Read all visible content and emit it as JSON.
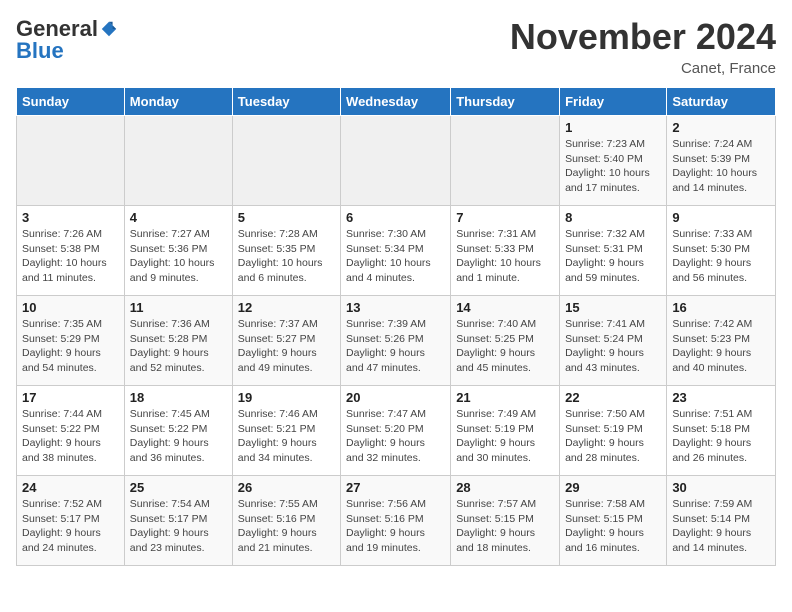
{
  "logo": {
    "general": "General",
    "blue": "Blue"
  },
  "title": "November 2024",
  "location": "Canet, France",
  "days_of_week": [
    "Sunday",
    "Monday",
    "Tuesday",
    "Wednesday",
    "Thursday",
    "Friday",
    "Saturday"
  ],
  "weeks": [
    [
      {
        "day": "",
        "info": ""
      },
      {
        "day": "",
        "info": ""
      },
      {
        "day": "",
        "info": ""
      },
      {
        "day": "",
        "info": ""
      },
      {
        "day": "",
        "info": ""
      },
      {
        "day": "1",
        "info": "Sunrise: 7:23 AM\nSunset: 5:40 PM\nDaylight: 10 hours and 17 minutes."
      },
      {
        "day": "2",
        "info": "Sunrise: 7:24 AM\nSunset: 5:39 PM\nDaylight: 10 hours and 14 minutes."
      }
    ],
    [
      {
        "day": "3",
        "info": "Sunrise: 7:26 AM\nSunset: 5:38 PM\nDaylight: 10 hours and 11 minutes."
      },
      {
        "day": "4",
        "info": "Sunrise: 7:27 AM\nSunset: 5:36 PM\nDaylight: 10 hours and 9 minutes."
      },
      {
        "day": "5",
        "info": "Sunrise: 7:28 AM\nSunset: 5:35 PM\nDaylight: 10 hours and 6 minutes."
      },
      {
        "day": "6",
        "info": "Sunrise: 7:30 AM\nSunset: 5:34 PM\nDaylight: 10 hours and 4 minutes."
      },
      {
        "day": "7",
        "info": "Sunrise: 7:31 AM\nSunset: 5:33 PM\nDaylight: 10 hours and 1 minute."
      },
      {
        "day": "8",
        "info": "Sunrise: 7:32 AM\nSunset: 5:31 PM\nDaylight: 9 hours and 59 minutes."
      },
      {
        "day": "9",
        "info": "Sunrise: 7:33 AM\nSunset: 5:30 PM\nDaylight: 9 hours and 56 minutes."
      }
    ],
    [
      {
        "day": "10",
        "info": "Sunrise: 7:35 AM\nSunset: 5:29 PM\nDaylight: 9 hours and 54 minutes."
      },
      {
        "day": "11",
        "info": "Sunrise: 7:36 AM\nSunset: 5:28 PM\nDaylight: 9 hours and 52 minutes."
      },
      {
        "day": "12",
        "info": "Sunrise: 7:37 AM\nSunset: 5:27 PM\nDaylight: 9 hours and 49 minutes."
      },
      {
        "day": "13",
        "info": "Sunrise: 7:39 AM\nSunset: 5:26 PM\nDaylight: 9 hours and 47 minutes."
      },
      {
        "day": "14",
        "info": "Sunrise: 7:40 AM\nSunset: 5:25 PM\nDaylight: 9 hours and 45 minutes."
      },
      {
        "day": "15",
        "info": "Sunrise: 7:41 AM\nSunset: 5:24 PM\nDaylight: 9 hours and 43 minutes."
      },
      {
        "day": "16",
        "info": "Sunrise: 7:42 AM\nSunset: 5:23 PM\nDaylight: 9 hours and 40 minutes."
      }
    ],
    [
      {
        "day": "17",
        "info": "Sunrise: 7:44 AM\nSunset: 5:22 PM\nDaylight: 9 hours and 38 minutes."
      },
      {
        "day": "18",
        "info": "Sunrise: 7:45 AM\nSunset: 5:22 PM\nDaylight: 9 hours and 36 minutes."
      },
      {
        "day": "19",
        "info": "Sunrise: 7:46 AM\nSunset: 5:21 PM\nDaylight: 9 hours and 34 minutes."
      },
      {
        "day": "20",
        "info": "Sunrise: 7:47 AM\nSunset: 5:20 PM\nDaylight: 9 hours and 32 minutes."
      },
      {
        "day": "21",
        "info": "Sunrise: 7:49 AM\nSunset: 5:19 PM\nDaylight: 9 hours and 30 minutes."
      },
      {
        "day": "22",
        "info": "Sunrise: 7:50 AM\nSunset: 5:19 PM\nDaylight: 9 hours and 28 minutes."
      },
      {
        "day": "23",
        "info": "Sunrise: 7:51 AM\nSunset: 5:18 PM\nDaylight: 9 hours and 26 minutes."
      }
    ],
    [
      {
        "day": "24",
        "info": "Sunrise: 7:52 AM\nSunset: 5:17 PM\nDaylight: 9 hours and 24 minutes."
      },
      {
        "day": "25",
        "info": "Sunrise: 7:54 AM\nSunset: 5:17 PM\nDaylight: 9 hours and 23 minutes."
      },
      {
        "day": "26",
        "info": "Sunrise: 7:55 AM\nSunset: 5:16 PM\nDaylight: 9 hours and 21 minutes."
      },
      {
        "day": "27",
        "info": "Sunrise: 7:56 AM\nSunset: 5:16 PM\nDaylight: 9 hours and 19 minutes."
      },
      {
        "day": "28",
        "info": "Sunrise: 7:57 AM\nSunset: 5:15 PM\nDaylight: 9 hours and 18 minutes."
      },
      {
        "day": "29",
        "info": "Sunrise: 7:58 AM\nSunset: 5:15 PM\nDaylight: 9 hours and 16 minutes."
      },
      {
        "day": "30",
        "info": "Sunrise: 7:59 AM\nSunset: 5:14 PM\nDaylight: 9 hours and 14 minutes."
      }
    ]
  ]
}
